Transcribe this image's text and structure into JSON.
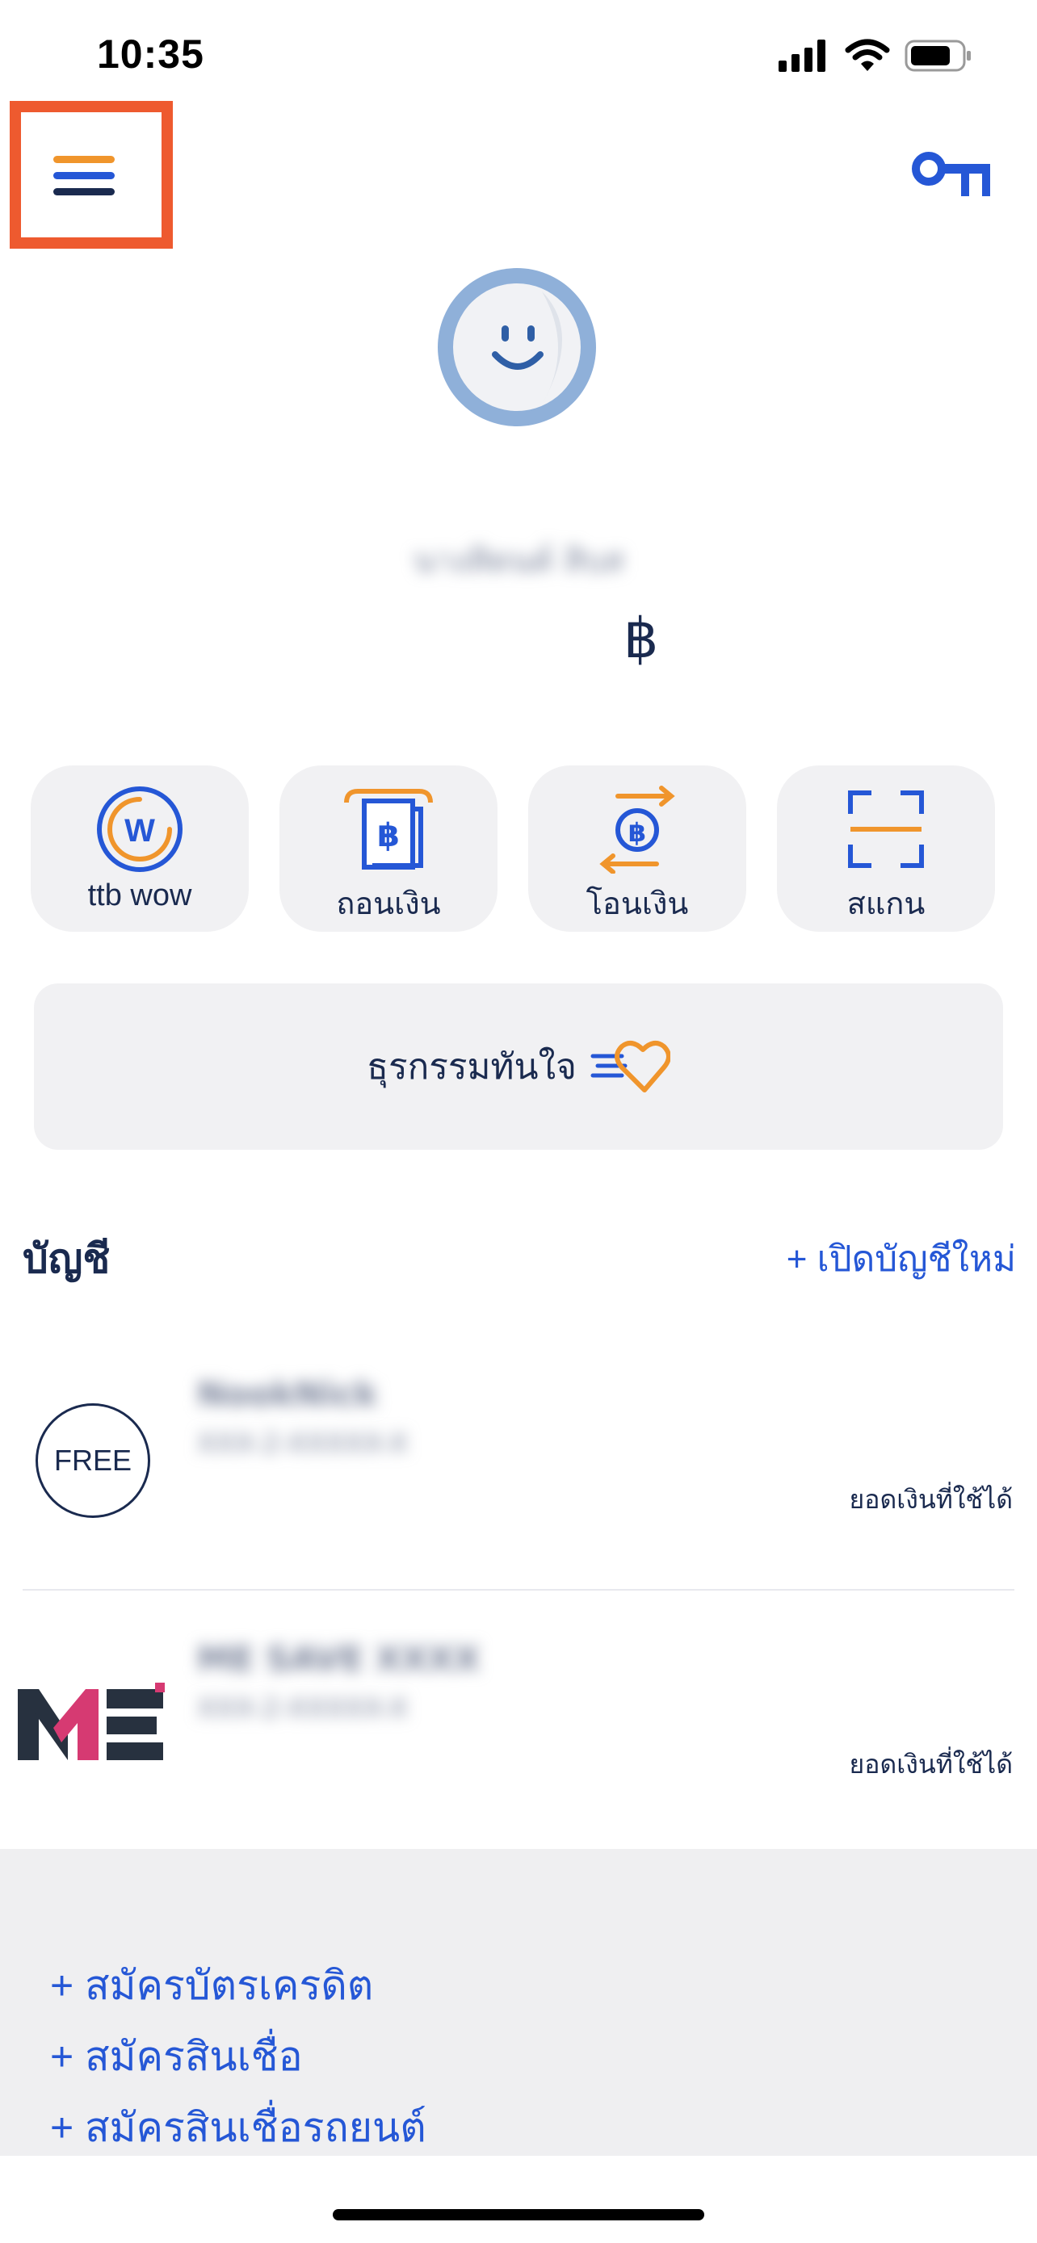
{
  "status_bar": {
    "time": "10:35"
  },
  "header": {
    "menu_icon": "hamburger-menu-icon",
    "key_icon": "key-icon"
  },
  "profile": {
    "avatar_icon": "smiley-avatar-icon",
    "name": "นางสิดนค์ สิบส",
    "currency_symbol": "฿"
  },
  "quick_actions": [
    {
      "label": "ttb wow",
      "icon": "ttb-wow-icon"
    },
    {
      "label": "ถอนเงิน",
      "icon": "withdraw-icon"
    },
    {
      "label": "โอนเงิน",
      "icon": "transfer-icon"
    },
    {
      "label": "สแกน",
      "icon": "scan-icon"
    }
  ],
  "instant_banner": {
    "label": "ธุรกรรมทันใจ",
    "icon": "heart-fast-icon"
  },
  "accounts": {
    "title": "บัญชี",
    "open_new_link": "+ เปิดบัญชีใหม่",
    "items": [
      {
        "badge": "FREE",
        "name": "NookNick",
        "number": "XXX-2-XXXXX-X",
        "balance_label": "ยอดเงินที่ใช้ได้"
      },
      {
        "logo": "ME",
        "name": "ME SAVE XXXX",
        "number": "XXX-2-XXXXX-X",
        "balance_label": "ยอดเงินที่ใช้ได้"
      }
    ]
  },
  "apply_links": [
    "+ สมัครบัตรเครดิต",
    "+ สมัครสินเชื่อ",
    "+ สมัครสินเชื่อรถยนต์"
  ],
  "colors": {
    "navy": "#1a2a4f",
    "accent_blue": "#2557d6",
    "accent_orange": "#f0952c",
    "highlight_red": "#ee5a2f",
    "card_grey": "#f1f1f3"
  }
}
